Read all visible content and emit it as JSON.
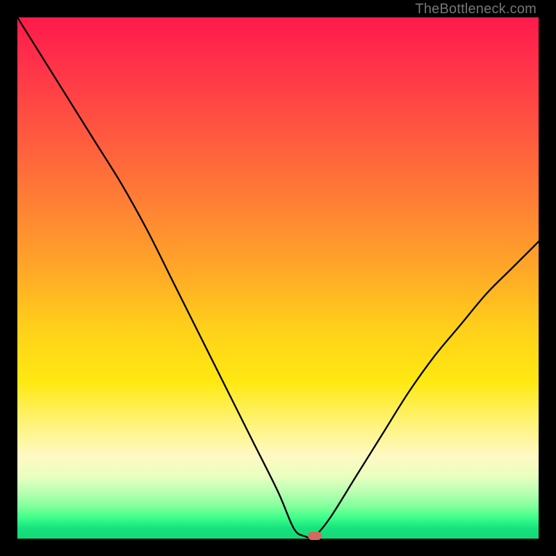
{
  "watermark": "TheBottleneck.com",
  "colors": {
    "frame": "#000000",
    "curve": "#000000",
    "marker": "#d46a5f",
    "gradient_top": "#ff1a4b",
    "gradient_bottom": "#14d878"
  },
  "chart_data": {
    "type": "line",
    "title": "",
    "xlabel": "",
    "ylabel": "",
    "xlim": [
      0,
      100
    ],
    "ylim": [
      0,
      100
    ],
    "grid": false,
    "legend": false,
    "note": "V-shaped bottleneck curve on red→green gradient; y≈bottleneck %, x≈component-ratio axis (unlabeled). Values estimated from curve pixels.",
    "series": [
      {
        "name": "bottleneck-curve",
        "x": [
          0,
          5,
          10,
          15,
          20,
          25,
          30,
          35,
          40,
          45,
          50,
          53,
          55,
          57,
          60,
          65,
          70,
          75,
          80,
          85,
          90,
          95,
          100
        ],
        "y": [
          100,
          92,
          84,
          76,
          68,
          59,
          49,
          39,
          29,
          19,
          9,
          2,
          0.5,
          0.5,
          4,
          12,
          20,
          28,
          35,
          41,
          47,
          52,
          57
        ]
      }
    ],
    "marker": {
      "x": 57,
      "y": 0.5
    },
    "gradient_stops": [
      {
        "pos": 0.0,
        "color": "#ff1a4b"
      },
      {
        "pos": 0.35,
        "color": "#ff7e35"
      },
      {
        "pos": 0.6,
        "color": "#ffd11a"
      },
      {
        "pos": 0.84,
        "color": "#fff9c2"
      },
      {
        "pos": 0.94,
        "color": "#7dff9a"
      },
      {
        "pos": 1.0,
        "color": "#14d878"
      }
    ]
  }
}
